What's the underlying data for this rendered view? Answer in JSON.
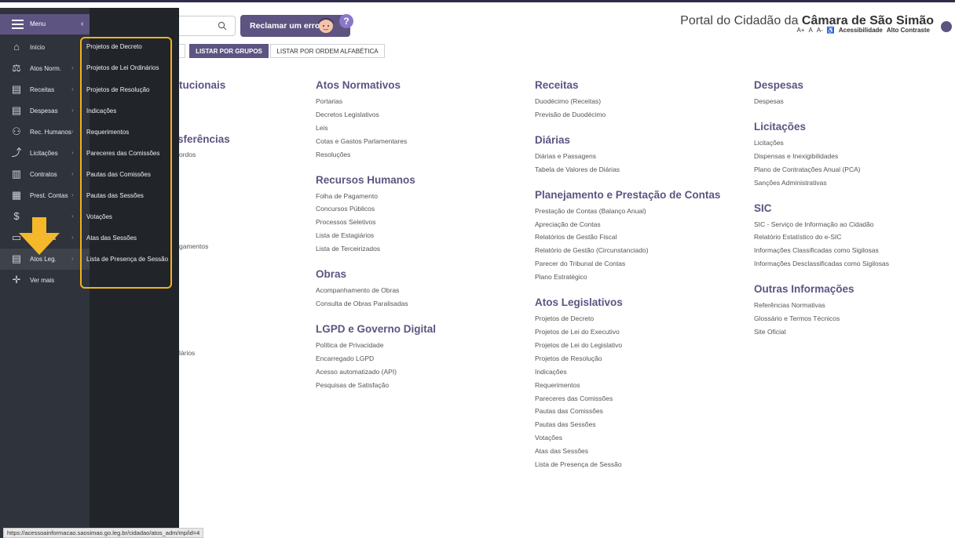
{
  "header": {
    "report_label": "Reclamar um erro",
    "help_label": "?",
    "portal_prefix": "Portal do Cidadão da",
    "portal_name": "Câmara de São Simão",
    "font_bigger": "A+",
    "font_normal": "A",
    "font_smaller": "A-",
    "accessibility": "Acessibilidade",
    "high_contrast": "Alto Contraste"
  },
  "tabs": {
    "groups": "LISTAR POR GRUPOS",
    "alpha": "LISTAR POR ORDEM ALFABÉTICA"
  },
  "sidebar": {
    "menu_label": "Menu",
    "items": [
      {
        "label": "Início",
        "icon": "home-icon"
      },
      {
        "label": "Atos Norm.",
        "icon": "scale-icon"
      },
      {
        "label": "Receitas",
        "icon": "money-icon"
      },
      {
        "label": "Despesas",
        "icon": "money-icon"
      },
      {
        "label": "Rec. Humanos",
        "icon": "people-icon"
      },
      {
        "label": "Licitações",
        "icon": "chart-icon"
      },
      {
        "label": "Contratos",
        "icon": "document-icon"
      },
      {
        "label": "Prest. Contas",
        "icon": "report-icon"
      },
      {
        "label": "",
        "icon": "dollar-icon"
      },
      {
        "label": "na",
        "icon": "computer-icon"
      },
      {
        "label": "Atos Leg.",
        "icon": "building-icon"
      },
      {
        "label": "Ver mais",
        "icon": "plus-icon"
      }
    ]
  },
  "submenu": {
    "items": [
      "Projetos de Decreto",
      "Projetos de Lei Ordinários",
      "Projetos de Resolução",
      "Indicações",
      "Requerimentos",
      "Pareceres das Comissões",
      "Pautas das Comissões",
      "Pautas das Sessões",
      "Votações",
      "Atas das Sessões",
      "Lista de Presença de Sessão"
    ]
  },
  "fragments": {
    "institucionais": "tucionais",
    "transferencias": "sferências",
    "acordos": "ordos",
    "pagamentos": "gamentos",
    "diarios": "lários"
  },
  "columns": {
    "col2": [
      {
        "title": "Atos Normativos",
        "links": [
          "Portarias",
          "Decretos Legislativos",
          "Leis",
          "Cotas e Gastos Parlamentares",
          "Resoluções"
        ]
      },
      {
        "title": "Recursos Humanos",
        "links": [
          "Folha de Pagamento",
          "Concursos Públicos",
          "Processos Seletivos",
          "Lista de Estagiários",
          "Lista de Terceirizados"
        ]
      },
      {
        "title": "Obras",
        "links": [
          "Acompanhamento de Obras",
          "Consulta de Obras Paralisadas"
        ]
      },
      {
        "title": "LGPD e Governo Digital",
        "links": [
          "Política de Privacidade",
          "Encarregado LGPD",
          "Acesso automatizado (API)",
          "Pesquisas de Satisfação"
        ]
      }
    ],
    "col3": [
      {
        "title": "Receitas",
        "links": [
          "Duodécimo (Receitas)",
          "Previsão de Duodécimo"
        ]
      },
      {
        "title": "Diárias",
        "links": [
          "Diárias e Passagens",
          "Tabela de Valores de Diárias"
        ]
      },
      {
        "title": "Planejamento e Prestação de Contas",
        "links": [
          "Prestação de Contas (Balanço Anual)",
          "Apreciação de Contas",
          "Relatórios de Gestão Fiscal",
          "Relatório de Gestão (Circunstanciado)",
          "Parecer do Tribunal de Contas",
          "Plano Estratégico"
        ]
      },
      {
        "title": "Atos Legislativos",
        "links": [
          "Projetos de Decreto",
          "Projetos de Lei do Executivo",
          "Projetos de Lei do Legislativo",
          "Projetos de Resolução",
          "Indicações",
          "Requerimentos",
          "Pareceres das Comissões",
          "Pautas das Comissões",
          "Pautas das Sessões",
          "Votações",
          "Atas das Sessões",
          "Lista de Presença de Sessão"
        ]
      }
    ],
    "col4": [
      {
        "title": "Despesas",
        "links": [
          "Despesas"
        ]
      },
      {
        "title": "Licitações",
        "links": [
          "Licitações",
          "Dispensas e Inexigibilidades",
          "Plano de Contratações Anual (PCA)",
          "Sanções Administrativas"
        ]
      },
      {
        "title": "SIC",
        "links": [
          "SIC - Serviço de Informação ao Cidadão",
          "Relatório Estatístico do e-SIC",
          "Informações Classificadas como Sigilosas",
          "Informações Desclassificadas como Sigilosas"
        ]
      },
      {
        "title": "Outras Informações",
        "links": [
          "Referências Normativas",
          "Glossário e Termos Técnicos",
          "Site Oficial"
        ]
      }
    ]
  },
  "statusbar": "https://acessoainformacao.saosimao.go.leg.br/cidadao/atos_adm/mp/id=4",
  "colors": {
    "accent": "#5d5481",
    "sidebar_bg": "#2f333b",
    "submenu_bg": "#212429",
    "highlight": "#f2b31a"
  }
}
